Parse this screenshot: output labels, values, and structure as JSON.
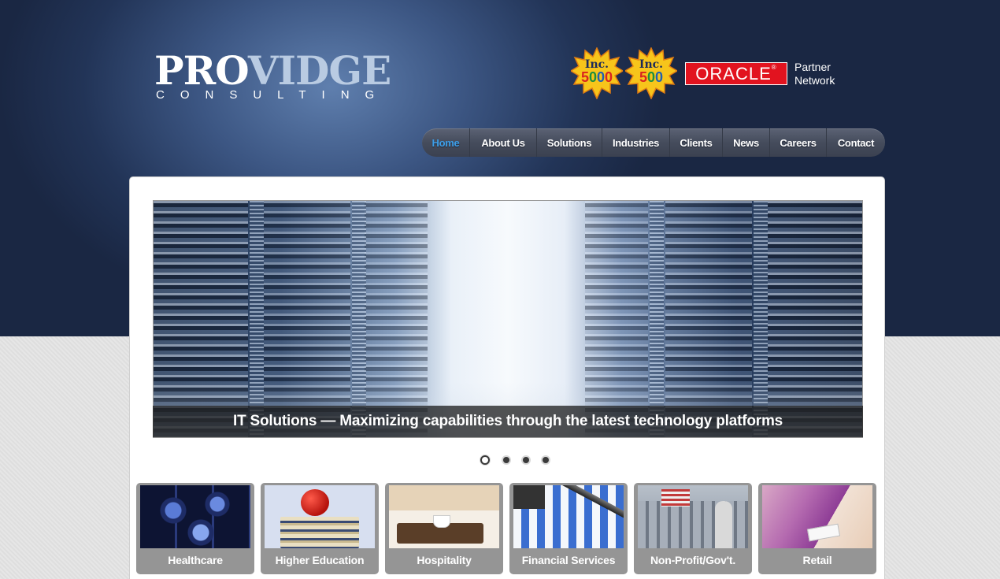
{
  "brand": {
    "logo_pro": "PRO",
    "logo_vidge": "VIDGE",
    "logo_sub": "CONSULTING"
  },
  "awards": [
    {
      "title": "Inc.",
      "number": "5000"
    },
    {
      "title": "Inc.",
      "number": "500"
    }
  ],
  "partner": {
    "oracle_label": "ORACLE",
    "line1": "Partner",
    "line2": "Network"
  },
  "nav": {
    "items": [
      {
        "label": "Home",
        "active": true
      },
      {
        "label": "About Us"
      },
      {
        "label": "Solutions"
      },
      {
        "label": "Industries"
      },
      {
        "label": "Clients"
      },
      {
        "label": "News"
      },
      {
        "label": "Careers"
      },
      {
        "label": "Contact"
      }
    ]
  },
  "slider": {
    "caption": "IT Solutions — Maximizing capabilities through the latest technology platforms",
    "slide_count": 4,
    "active_index": 0
  },
  "industries": [
    {
      "label": "Healthcare"
    },
    {
      "label": "Higher Education"
    },
    {
      "label": "Hospitality"
    },
    {
      "label": "Financial Services"
    },
    {
      "label": "Non-Profit/Gov't."
    },
    {
      "label": "Retail"
    }
  ],
  "colors": {
    "header_dark": "#1a2743",
    "nav_active": "#3d9ee8",
    "oracle_red": "#e2131f",
    "tile_gray": "#959595"
  }
}
